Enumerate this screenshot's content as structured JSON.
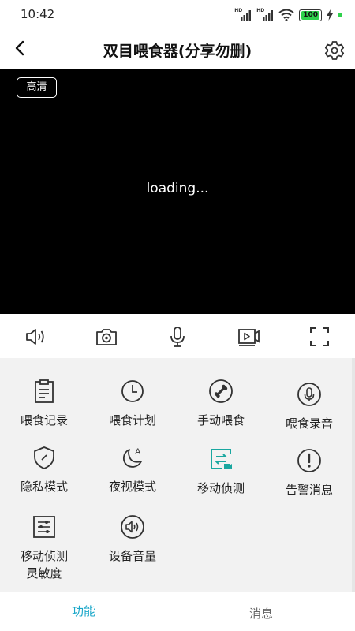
{
  "status_bar": {
    "time": "10:42",
    "signal1": "HD",
    "signal2": "HD",
    "battery": "100"
  },
  "header": {
    "title": "双目喂食器(分享勿删)"
  },
  "video": {
    "quality": "高清",
    "loading_text": "loading..."
  },
  "controls": {
    "icons": [
      "speaker-icon",
      "camera-icon",
      "microphone-icon",
      "record-icon",
      "fullscreen-icon"
    ]
  },
  "functions": [
    {
      "label": "喂食记录",
      "icon": "clipboard-icon"
    },
    {
      "label": "喂食计划",
      "icon": "clock-icon"
    },
    {
      "label": "手动喂食",
      "icon": "bone-icon"
    },
    {
      "label": "喂食录音",
      "icon": "microphone-icon"
    },
    {
      "label": "隐私模式",
      "icon": "shield-icon"
    },
    {
      "label": "夜视模式",
      "icon": "moon-icon"
    },
    {
      "label": "移动侦测",
      "icon": "motion-icon"
    },
    {
      "label": "告警消息",
      "icon": "alert-icon"
    },
    {
      "label": "移动侦测\n灵敏度",
      "icon": "sliders-icon"
    },
    {
      "label": "设备音量",
      "icon": "volume-icon"
    }
  ],
  "tabs": [
    {
      "label": "功能",
      "active": true
    },
    {
      "label": "消息",
      "active": false
    }
  ],
  "colors": {
    "accent": "#1aa7c9",
    "motion_icon": "#1aa7a0",
    "panel_bg": "#f2f2f2"
  }
}
